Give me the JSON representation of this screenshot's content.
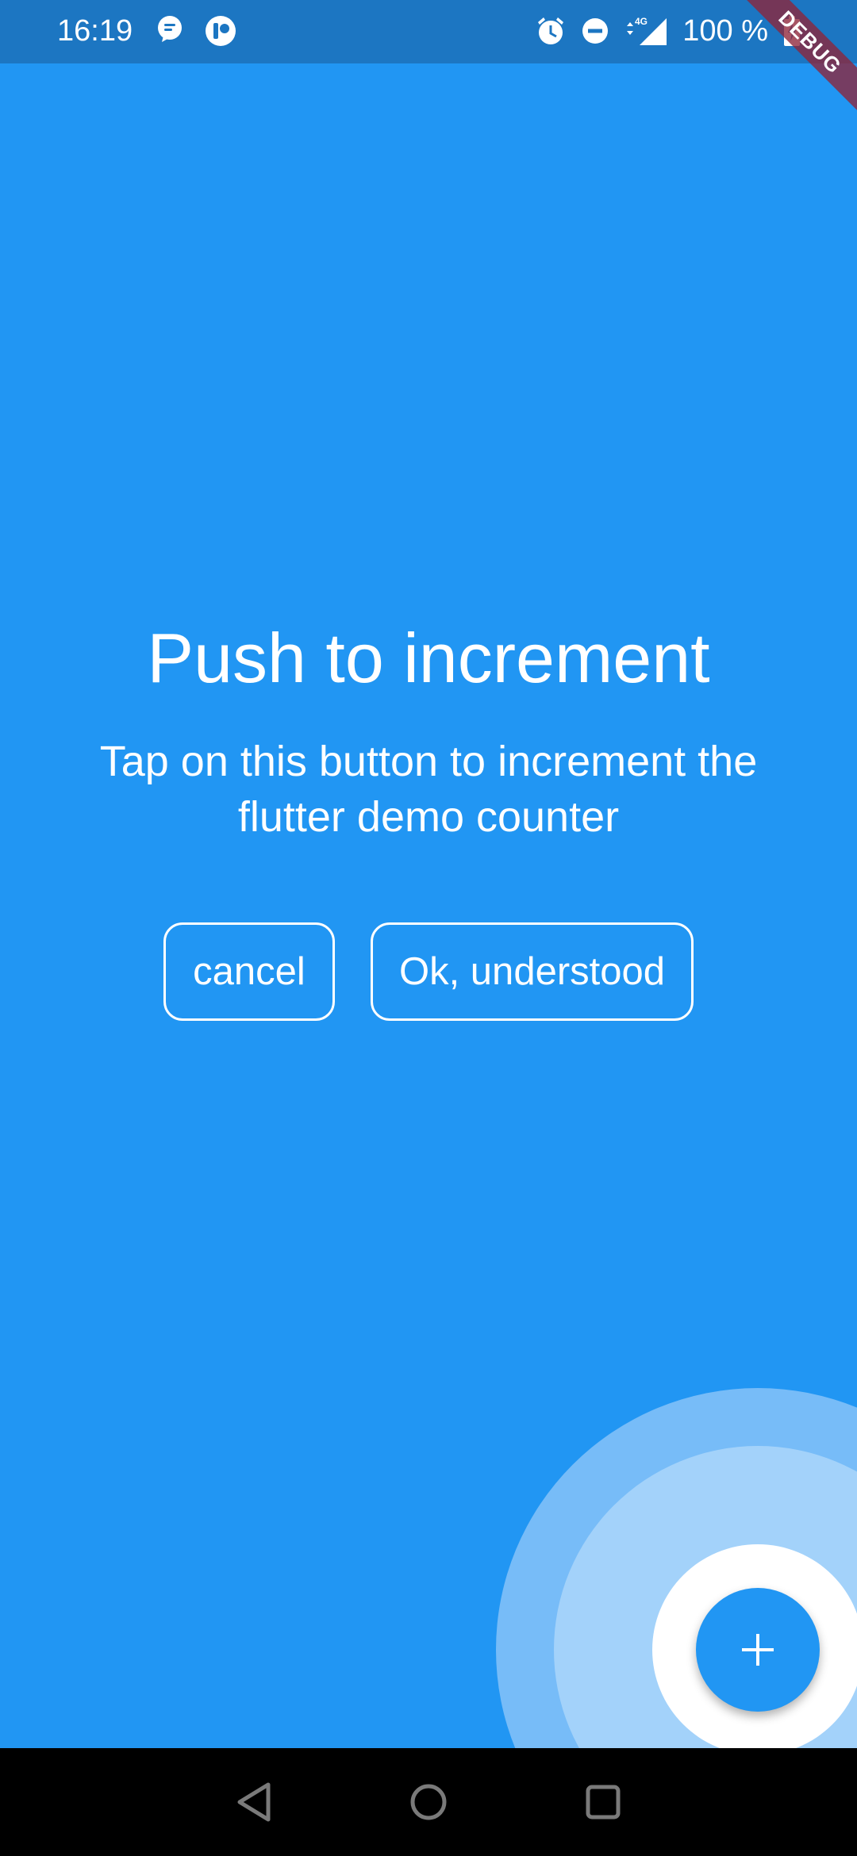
{
  "status_bar": {
    "time": "16:19",
    "battery": "100 %",
    "left_icons": [
      "message-icon",
      "app-notification-icon"
    ],
    "right_icons": [
      "alarm-icon",
      "do-not-disturb-icon",
      "signal-4g-icon",
      "battery-charging-icon"
    ]
  },
  "debug_banner": {
    "label": "DEBUG"
  },
  "showcase": {
    "title": "Push to increment",
    "description": "Tap on this button to increment the flutter demo counter",
    "cancel_label": "cancel",
    "ok_label": "Ok, understood"
  },
  "fab": {
    "icon": "plus-icon"
  },
  "nav_bar": {
    "buttons": [
      "back-icon",
      "home-icon",
      "recents-icon"
    ]
  },
  "colors": {
    "background": "#2196F3",
    "status_bar": "#1C76C2",
    "ring_outer": "#77BCF8",
    "ring_middle": "#A3D2FA",
    "fab": "#2196F3",
    "debug_banner": "#8E2438"
  }
}
